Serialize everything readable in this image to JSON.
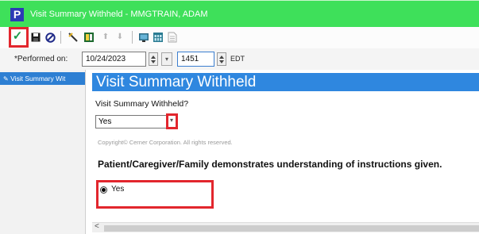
{
  "window": {
    "title": "Visit Summary Withheld - MMGTRAIN, ADAM",
    "app_icon_letter": "P"
  },
  "toolbar": {
    "icons": [
      "checkmark-sign-icon",
      "save-icon",
      "cancel-icon",
      "tools-icon",
      "reference-icon",
      "up-arrow-icon",
      "down-arrow-icon",
      "monitor-icon",
      "calendar-icon",
      "document-icon"
    ],
    "check_glyph": "✓",
    "up_glyph": "⬆",
    "down_glyph": "⬇"
  },
  "performed": {
    "label": "*Performed on:",
    "date": "10/24/2023",
    "time": "1451",
    "timezone": "EDT"
  },
  "sidebar": {
    "items": [
      {
        "label": "Visit Summary Wit"
      }
    ]
  },
  "form": {
    "header": "Visit Summary Withheld",
    "question": "Visit Summary Withheld?",
    "selected_value": "Yes",
    "copyright": "Copyright© Cerner Corporation. All rights reserved.",
    "statement": "Patient/Caregiver/Family demonstrates understanding of instructions given.",
    "radio_options": [
      {
        "label": "Yes",
        "checked": true
      }
    ]
  },
  "scrollbar": {
    "left_arrow": "<"
  },
  "colors": {
    "titlebar": "#3ee05a",
    "accent": "#2f87df",
    "highlight": "#e2262d"
  }
}
